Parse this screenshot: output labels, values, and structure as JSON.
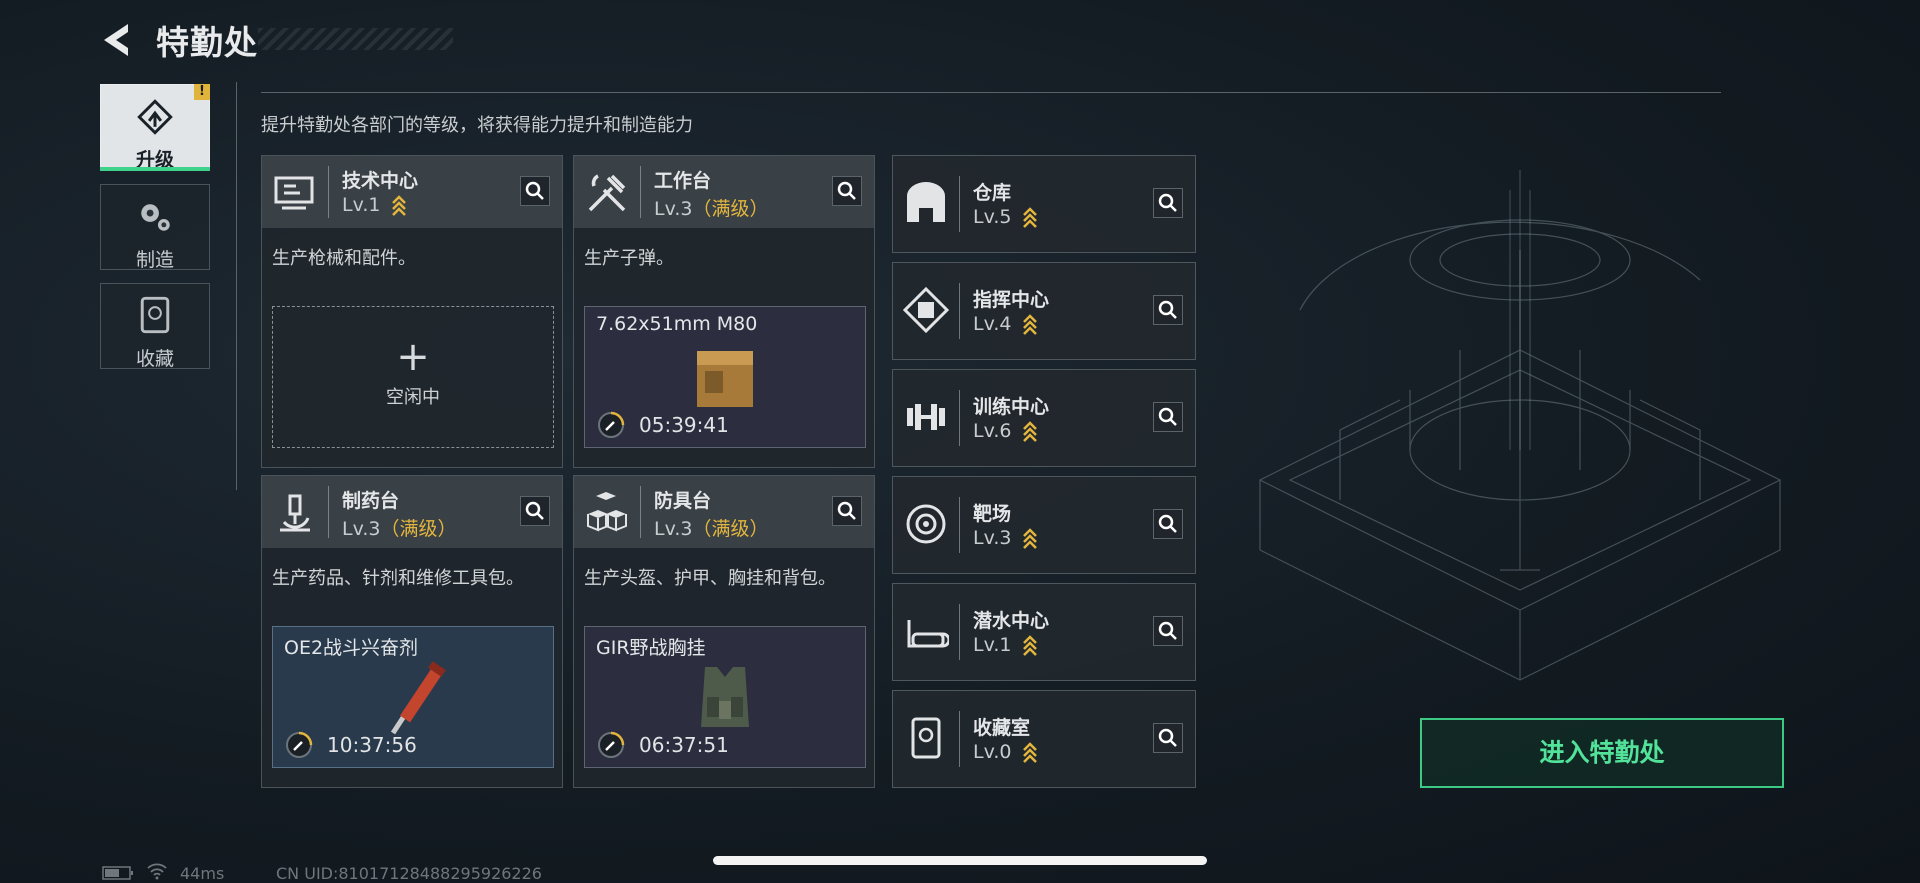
{
  "header": {
    "title": "特勤处"
  },
  "nav": [
    {
      "label": "升级",
      "icon": "upgrade-icon",
      "active": true,
      "badge": "!"
    },
    {
      "label": "制造",
      "icon": "gears-icon",
      "active": false
    },
    {
      "label": "收藏",
      "icon": "collection-icon",
      "active": false
    }
  ],
  "subtitle": "提升特勤处各部门的等级，将获得能力提升和制造能力",
  "cards": [
    {
      "name": "技术中心",
      "level": "Lv.1",
      "max": "",
      "desc": "生产枪械和配件。",
      "slot": {
        "idle": true,
        "idle_label": "空闲中",
        "plus": "+"
      }
    },
    {
      "name": "工作台",
      "level": "Lv.3",
      "max": "（满级）",
      "desc": "生产子弹。",
      "slot": {
        "idle": false,
        "item": "7.62x51mm M80",
        "timer": "05:39:41"
      }
    },
    {
      "name": "制药台",
      "level": "Lv.3",
      "max": "（满级）",
      "desc": "生产药品、针剂和维修工具包。",
      "slot": {
        "idle": false,
        "item": "OE2战斗兴奋剂",
        "timer": "10:37:56"
      }
    },
    {
      "name": "防具台",
      "level": "Lv.3",
      "max": "（满级）",
      "desc": "生产头盔、护甲、胸挂和背包。",
      "slot": {
        "idle": false,
        "item": "GIR野战胸挂",
        "timer": "06:37:51"
      }
    }
  ],
  "rooms": [
    {
      "name": "仓库",
      "level": "Lv.5"
    },
    {
      "name": "指挥中心",
      "level": "Lv.4"
    },
    {
      "name": "训练中心",
      "level": "Lv.6"
    },
    {
      "name": "靶场",
      "level": "Lv.3"
    },
    {
      "name": "潜水中心",
      "level": "Lv.1"
    },
    {
      "name": "收藏室",
      "level": "Lv.0"
    }
  ],
  "enter_button": "进入特勤处",
  "footer": {
    "ping": "44ms",
    "uid": "CN UID:81017128488295926226"
  },
  "colors": {
    "accent_green": "#3cc984",
    "gold": "#e3b53c"
  }
}
